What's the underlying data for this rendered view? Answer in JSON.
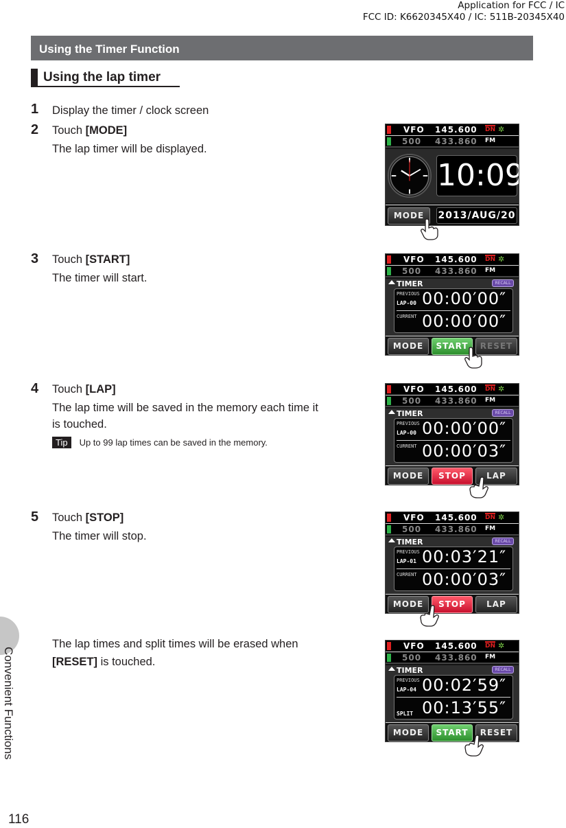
{
  "header_notice": {
    "line1": "Application for FCC / IC",
    "line2": "FCC ID: K6620345X40 / IC: 511B-20345X40"
  },
  "section_title": "Using the Timer Function",
  "subsection_title": "Using the lap timer",
  "steps": [
    {
      "num": "1",
      "text": "Display the timer / clock screen"
    },
    {
      "num": "2",
      "prefix": "Touch ",
      "key": "[MODE]",
      "desc": "The lap timer will be displayed."
    },
    {
      "num": "3",
      "prefix": "Touch ",
      "key": "[START]",
      "desc": "The timer will start."
    },
    {
      "num": "4",
      "prefix": "Touch ",
      "key": "[LAP]",
      "desc1": "The lap time will be saved in the memory each time it",
      "desc2": "is touched."
    },
    {
      "num": "5",
      "prefix": "Touch ",
      "key": "[STOP]",
      "desc": "The timer will stop."
    }
  ],
  "tip": {
    "tag": "Tip",
    "text": "Up to 99 lap times can be saved in the memory."
  },
  "reset_note": {
    "line1": "The lap times and split times will be erased when",
    "key": "[RESET]",
    "suffix": " is touched."
  },
  "side_label": "Convenient Functions",
  "page_number": "116",
  "radio_header": {
    "mode": "VFO",
    "freq_a": "145.600",
    "channel": "500",
    "freq_b": "433.860",
    "dn": "DN",
    "fm": "FM",
    "gps_icon": "gps-icon"
  },
  "screens": {
    "clock": {
      "time": "10:09",
      "date": "2013/AUG/20",
      "mode_btn": "MODE"
    },
    "s3": {
      "title": "TIMER",
      "recall": "RECALL",
      "prev_label": "PREVIOUS",
      "lap": "LAP-00",
      "prev_time": "00:00′00″",
      "cur_label": "CURRENT",
      "cur_time": "00:00′00″",
      "btns": [
        "MODE",
        "START",
        "RESET"
      ]
    },
    "s4": {
      "title": "TIMER",
      "recall": "RECALL",
      "prev_label": "PREVIOUS",
      "lap": "LAP-00",
      "prev_time": "00:00′00″",
      "cur_label": "CURRENT",
      "cur_time": "00:00′03″",
      "btns": [
        "MODE",
        "STOP",
        "LAP"
      ]
    },
    "s5": {
      "title": "TIMER",
      "recall": "RECALL",
      "prev_label": "PREVIOUS",
      "lap": "LAP-01",
      "prev_time": "00:03′21″",
      "cur_label": "CURRENT",
      "cur_time": "00:00′03″",
      "btns": [
        "MODE",
        "STOP",
        "LAP"
      ]
    },
    "s6": {
      "title": "TIMER",
      "recall": "RECALL",
      "prev_label": "PREVIOUS",
      "lap": "LAP-04",
      "prev_time": "00:02′59″",
      "cur_label": "SPLIT",
      "cur_time": "00:13′55″",
      "btns": [
        "MODE",
        "START",
        "RESET"
      ]
    }
  },
  "colors": {
    "section_bar": "#6d6e71",
    "start_green": "#2d8f2d",
    "stop_red": "#c8102e",
    "recall_purple": "#6a4aa8"
  }
}
